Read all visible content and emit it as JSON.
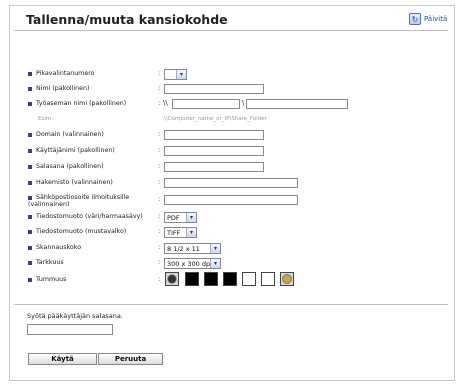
{
  "page": {
    "title": "Tallenna/muuta kansiokohde",
    "refresh_label": "Päivitä"
  },
  "fields": {
    "pikavalinta": {
      "label": "Pikavalintanumero",
      "value": ""
    },
    "nimi": {
      "label": "Nimi (pakollinen)",
      "value": ""
    },
    "tyoasema": {
      "label": "Työaseman nimi (pakollinen)",
      "prefix": "\\\\",
      "separator": "\\",
      "value1": "",
      "value2": ""
    },
    "example": {
      "label": "Esim.:",
      "text": "\\\\Computer_name_or_IP\\Share_Folder"
    },
    "domain": {
      "label": "Domain (valinnainen)",
      "value": ""
    },
    "kayttajanimi": {
      "label": "Käyttäjänimi (pakollinen)",
      "value": ""
    },
    "salasana": {
      "label": "Salasana (pakollinen)",
      "value": ""
    },
    "hakemisto": {
      "label": "Hakemisto (valinnainen)",
      "value": ""
    },
    "sahkoposti": {
      "label_line1": "Sähköpostiosoite ilmoituksille",
      "label_line2": "(valinnainen)",
      "value": ""
    },
    "tiedosto_vari": {
      "label": "Tiedostomuoto (väri/harmaasävy)",
      "value": "PDF"
    },
    "tiedosto_mv": {
      "label": "Tiedostomuoto (mustavalko)",
      "value": "TIFF"
    },
    "skannauskoko": {
      "label": "Skannauskoko",
      "value": "8 1/2 x 11"
    },
    "tarkkuus": {
      "label": "Tarkkuus",
      "value": "300 x 300 dpi"
    },
    "tummuus": {
      "label": "Tummuus"
    }
  },
  "admin": {
    "label": "Syötä pääkäyttäjän salasana.",
    "value": ""
  },
  "buttons": {
    "apply": "Käytä",
    "cancel": "Peruuta"
  },
  "colors": {
    "bullet": "#3d3d8a",
    "link": "#2a4d8f",
    "rule": "#bfbfbf"
  }
}
